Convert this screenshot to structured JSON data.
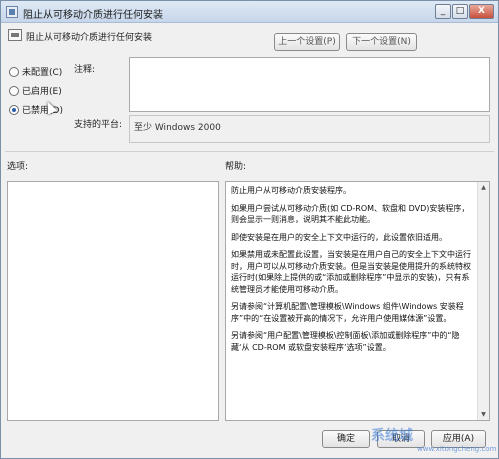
{
  "window": {
    "title": "阻止从可移动介质进行任何安装",
    "minimize": "_",
    "maximize": "□",
    "close": "X"
  },
  "header": {
    "title": "阻止从可移动介质进行任何安装",
    "prev_setting": "上一个设置(P)",
    "next_setting": "下一个设置(N)"
  },
  "state_options": [
    {
      "label": "未配置(C)",
      "checked": false
    },
    {
      "label": "已启用(E)",
      "checked": false
    },
    {
      "label": "已禁用(D)",
      "checked": true
    }
  ],
  "comment": {
    "label": "注释:",
    "value": ""
  },
  "supported": {
    "label": "支持的平台:",
    "value": "至少 Windows 2000"
  },
  "options": {
    "label": "选项:"
  },
  "help": {
    "label": "帮助:",
    "paragraphs": [
      "防止用户从可移动介质安装程序。",
      "如果用户尝试从可移动介质(如 CD-ROM、软盘和 DVD)安装程序，则会显示一则消息，说明其不能此功能。",
      "即使安装是在用户的安全上下文中运行的，此设置依旧适用。",
      "如果禁用或未配置此设置，当安装是在用户自己的安全上下文中运行时，用户可以从可移动介质安装。但是当安装是使用提升的系统特权运行时(如果除上提供的或“添加或删除程序”中显示的安装)，只有系统管理员才能使用可移动介质。",
      "另请参阅“计算机配置\\管理模板\\Windows 组件\\Windows 安装程序”中的“在设置被开高的情况下，允许用户使用媒体源”设置。",
      "另请参阅“用户配置\\管理模板\\控制面板\\添加或删除程序”中的“隐藏‘从 CD-ROM 或软盘安装程序’选项”设置。"
    ]
  },
  "footer": {
    "ok": "确定",
    "cancel": "取消",
    "apply": "应用(A)"
  },
  "watermark": {
    "logo": "系统城",
    "url": "www.xitongcheng.com"
  }
}
